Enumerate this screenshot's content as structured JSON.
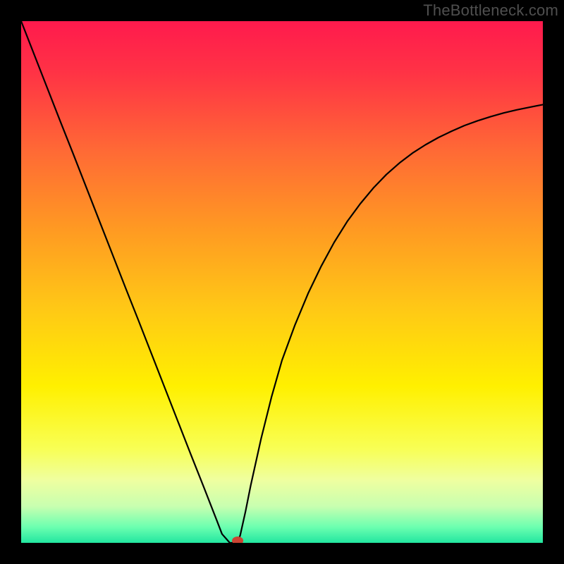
{
  "watermark": "TheBottleneck.com",
  "chart_data": {
    "type": "line",
    "title": "",
    "xlabel": "",
    "ylabel": "",
    "xlim": [
      0,
      1
    ],
    "ylim": [
      0,
      1
    ],
    "background_gradient": {
      "type": "vertical",
      "stops": [
        {
          "pos": 0.0,
          "color": "#ff1a4d"
        },
        {
          "pos": 0.1,
          "color": "#ff3345"
        },
        {
          "pos": 0.25,
          "color": "#ff6a35"
        },
        {
          "pos": 0.4,
          "color": "#ff9a22"
        },
        {
          "pos": 0.55,
          "color": "#ffc816"
        },
        {
          "pos": 0.7,
          "color": "#fff000"
        },
        {
          "pos": 0.82,
          "color": "#f8ff55"
        },
        {
          "pos": 0.88,
          "color": "#efffa0"
        },
        {
          "pos": 0.93,
          "color": "#c8ffb0"
        },
        {
          "pos": 0.97,
          "color": "#6bffb0"
        },
        {
          "pos": 1.0,
          "color": "#22e6a0"
        }
      ]
    },
    "series": [
      {
        "name": "curve",
        "color": "#000000",
        "x": [
          0.0,
          0.025,
          0.05,
          0.075,
          0.1,
          0.125,
          0.15,
          0.175,
          0.2,
          0.225,
          0.25,
          0.275,
          0.3,
          0.325,
          0.35,
          0.375,
          0.385,
          0.4,
          0.415,
          0.42,
          0.43,
          0.44,
          0.46,
          0.48,
          0.5,
          0.525,
          0.55,
          0.575,
          0.6,
          0.625,
          0.65,
          0.675,
          0.7,
          0.725,
          0.75,
          0.775,
          0.8,
          0.825,
          0.85,
          0.875,
          0.9,
          0.925,
          0.95,
          0.975,
          1.0
        ],
        "y": [
          1.0,
          0.936,
          0.872,
          0.808,
          0.745,
          0.681,
          0.617,
          0.553,
          0.489,
          0.426,
          0.362,
          0.298,
          0.234,
          0.17,
          0.107,
          0.043,
          0.017,
          0.0,
          0.0,
          0.015,
          0.06,
          0.11,
          0.2,
          0.28,
          0.35,
          0.418,
          0.478,
          0.53,
          0.576,
          0.616,
          0.65,
          0.68,
          0.706,
          0.728,
          0.747,
          0.763,
          0.777,
          0.789,
          0.8,
          0.809,
          0.817,
          0.824,
          0.83,
          0.835,
          0.84
        ]
      }
    ],
    "annotations": [
      {
        "name": "marker",
        "type": "point",
        "x": 0.415,
        "y": 0.004,
        "color": "#cc4433",
        "rx": 8,
        "ry": 6
      }
    ]
  }
}
